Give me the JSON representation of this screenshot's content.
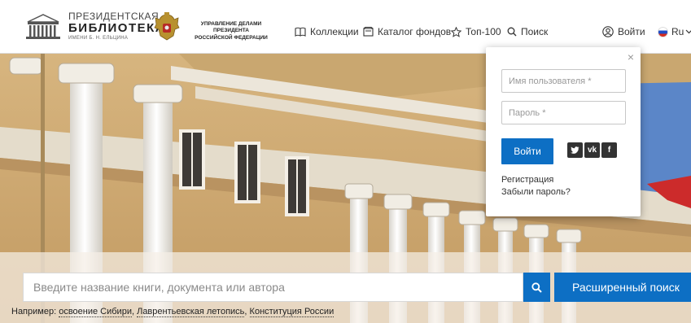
{
  "header": {
    "logo": {
      "line1": "ПРЕЗИДЕНТСКАЯ",
      "line2": "БИБЛИОТЕКА",
      "line3": "ИМЕНИ Б. Н. ЕЛЬЦИНА"
    },
    "admin": {
      "line1": "УПРАВЛЕНИЕ ДЕЛАМИ ПРЕЗИДЕНТА",
      "line2": "РОССИЙСКОЙ ФЕДЕРАЦИИ"
    },
    "nav": {
      "collections": "Коллекции",
      "catalog": "Каталог фондов",
      "top": "Топ-100",
      "search": "Поиск",
      "login": "Войти",
      "lang": "Ru"
    }
  },
  "icons": {
    "collections": "book-open-icon",
    "catalog": "catalog-icon",
    "top": "star-icon",
    "search": "search-icon",
    "login": "user-icon",
    "lang": "flag-ru-icon"
  },
  "login_popup": {
    "close": "×",
    "username_placeholder": "Имя пользователя *",
    "password_placeholder": "Пароль *",
    "submit": "Войти",
    "social": [
      "twitter",
      "vk",
      "facebook"
    ],
    "register": "Регистрация",
    "forgot": "Забыли пароль?"
  },
  "search": {
    "placeholder": "Введите название книги, документа или автора",
    "advanced": "Расширенный поиск",
    "example_prefix": "Например:",
    "examples": [
      "освоение Сибири",
      "Лаврентьевская летопись",
      "Конституция России"
    ]
  },
  "colors": {
    "accent": "#0d6fc4",
    "building": "#c8a36b"
  }
}
